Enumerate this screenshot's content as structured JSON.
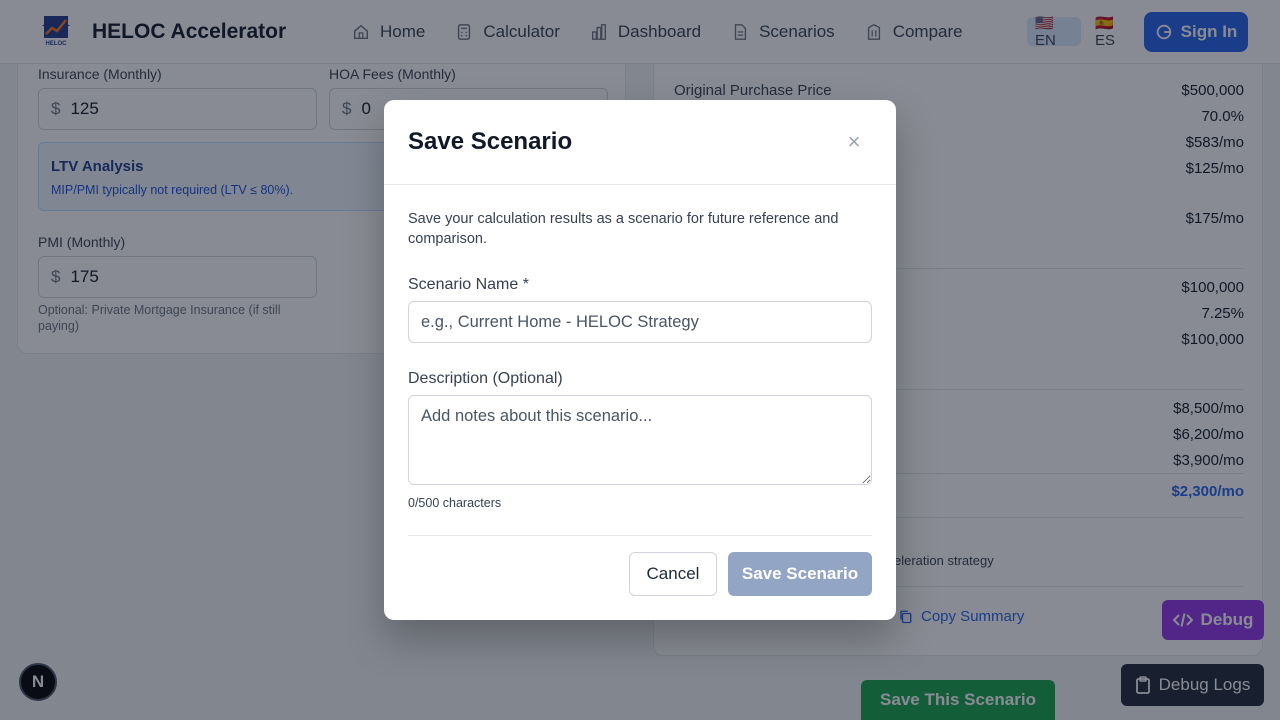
{
  "header": {
    "brand": "HELOC Accelerator",
    "nav": [
      {
        "label": "Home",
        "icon": "home-icon"
      },
      {
        "label": "Calculator",
        "icon": "calculator-icon"
      },
      {
        "label": "Dashboard",
        "icon": "chart-bar-icon"
      },
      {
        "label": "Scenarios",
        "icon": "document-icon"
      },
      {
        "label": "Compare",
        "icon": "building-icon"
      }
    ],
    "lang_en": "🇺🇸EN",
    "lang_es": "🇪🇸ES",
    "sign_in": "Sign In"
  },
  "left": {
    "insurance_label": "Insurance (Monthly)",
    "insurance_value": "125",
    "hoa_label": "HOA Fees (Monthly)",
    "hoa_value": "0",
    "currency": "$",
    "ltv_title": "LTV Analysis",
    "ltv_text": "MIP/PMI typically not required (LTV ≤ 80%).",
    "pmi_label": "PMI (Monthly)",
    "pmi_value": "175",
    "pmi_hint": "Optional: Private Mortgage Insurance (if still paying)"
  },
  "right": {
    "original_price_label": "Original Purchase Price",
    "values": [
      "$500,000",
      "70.0%",
      "$583/mo",
      "$125/mo",
      "$175/mo",
      "$100,000",
      "7.25%",
      "$100,000",
      "$8,500/mo",
      "$6,200/mo",
      "$3,900/mo",
      "$2,300/mo"
    ],
    "strategy_text": "eleration strategy",
    "copy_summary": "Copy Summary"
  },
  "floating": {
    "save_this": "Save This Scenario",
    "debug": "Debug",
    "debug_logs": "Debug Logs",
    "n_badge": "N"
  },
  "modal": {
    "title": "Save Scenario",
    "close": "×",
    "description": "Save your calculation results as a scenario for future reference and comparison.",
    "name_label": "Scenario Name *",
    "name_placeholder": "e.g., Current Home - HELOC Strategy",
    "desc_label": "Description (Optional)",
    "desc_placeholder": "Add notes about this scenario...",
    "char_count": "0/500 characters",
    "cancel": "Cancel",
    "save": "Save Scenario"
  }
}
